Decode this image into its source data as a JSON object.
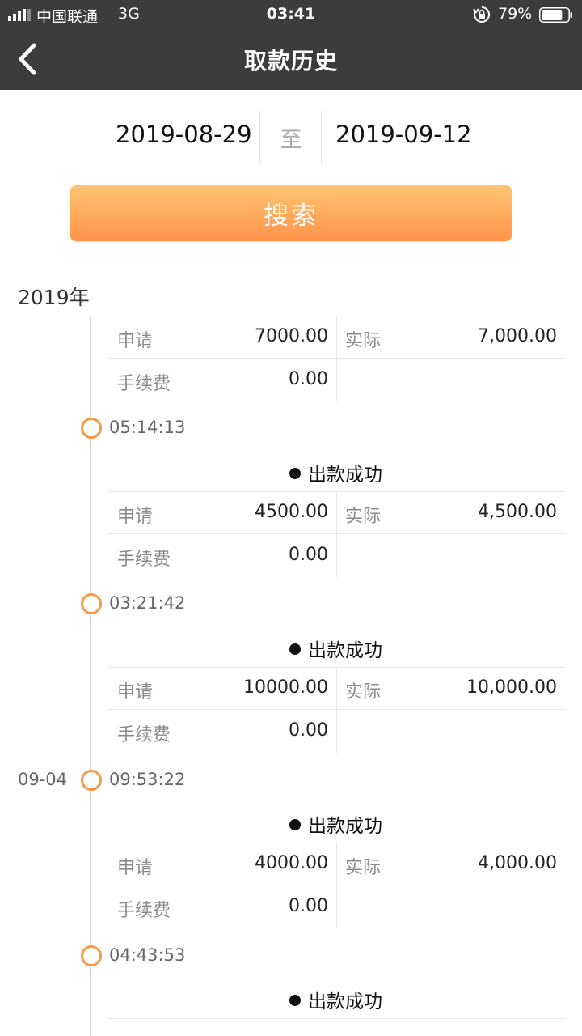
{
  "status_bar": {
    "carrier": "中国联通",
    "network": "3G",
    "time": "03:41",
    "battery": "79%",
    "battery_level": 0.79
  },
  "nav": {
    "title": "取款历史"
  },
  "filter": {
    "start_date": "2019-08-29",
    "separator": "至",
    "end_date": "2019-09-12",
    "search_label": "搜索"
  },
  "year": "2019年",
  "labels": {
    "apply": "申请",
    "actual": "实际",
    "fee": "手续费",
    "status_success": "出款成功"
  },
  "records": [
    {
      "apply": "7000.00",
      "actual": "7,000.00",
      "fee": "0.00"
    },
    {
      "time": "05:14:13",
      "status": "出款成功",
      "apply": "4500.00",
      "actual": "4,500.00",
      "fee": "0.00"
    },
    {
      "time": "03:21:42",
      "status": "出款成功",
      "apply": "10000.00",
      "actual": "10,000.00",
      "fee": "0.00"
    },
    {
      "date": "09-04",
      "time": "09:53:22",
      "status": "出款成功",
      "apply": "4000.00",
      "actual": "4,000.00",
      "fee": "0.00"
    },
    {
      "time": "04:43:53",
      "status": "出款成功"
    }
  ],
  "colors": {
    "header_bg": "#3c3c3c",
    "accent_orange": "#f29a4a",
    "button_top": "#ffc472",
    "button_bottom": "#ff944a"
  }
}
